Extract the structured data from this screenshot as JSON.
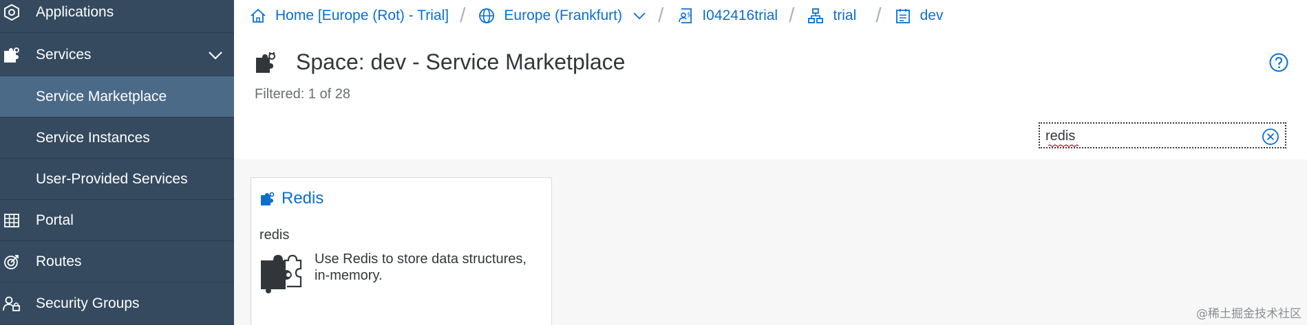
{
  "sidebar": {
    "items": [
      {
        "label": "Applications",
        "icon": "cube-icon"
      },
      {
        "label": "Services",
        "icon": "puzzle-icon",
        "expanded": true
      },
      {
        "label": "Service Marketplace",
        "selected": true
      },
      {
        "label": "Service Instances"
      },
      {
        "label": "User-Provided Services"
      },
      {
        "label": "Portal",
        "icon": "grid-icon"
      },
      {
        "label": "Routes",
        "icon": "target-icon"
      },
      {
        "label": "Security Groups",
        "icon": "user-lock-icon"
      }
    ]
  },
  "breadcrumb": {
    "items": [
      {
        "label": "Home [Europe (Rot) - Trial]",
        "icon": "home-icon"
      },
      {
        "label": "Europe (Frankfurt)",
        "icon": "globe-icon",
        "dropdown": true
      },
      {
        "label": "I042416trial",
        "icon": "account-icon"
      },
      {
        "label": "trial",
        "icon": "org-icon"
      },
      {
        "label": "dev",
        "icon": "space-icon"
      }
    ]
  },
  "page": {
    "title": "Space: dev - Service Marketplace",
    "filtered": "Filtered: 1 of 28"
  },
  "search": {
    "value": "redis",
    "placeholder": ""
  },
  "tiles": [
    {
      "name": "Redis",
      "subtitle": "redis",
      "description": "Use Redis to store data structures, in-memory."
    }
  ],
  "watermark": "@稀土掘金技术社区",
  "colors": {
    "sidebar_bg": "#354a5f",
    "sidebar_selected": "#4b6a88",
    "link": "#0a6ed1",
    "text": "#32363a"
  }
}
